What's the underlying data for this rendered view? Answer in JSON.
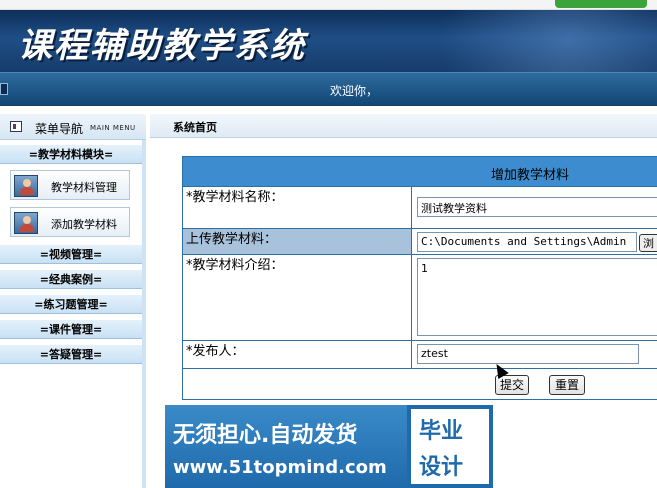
{
  "banner": {
    "title": "课程辅助教学系统"
  },
  "welcome": {
    "text": "欢迎你，"
  },
  "sidebar": {
    "menu_title": "菜单导航",
    "menu_title_en": "MAIN MENU",
    "modules": [
      {
        "label": "=教学材料模块="
      },
      {
        "label": "=视频管理="
      },
      {
        "label": "=经典案例="
      },
      {
        "label": "=练习题管理="
      },
      {
        "label": "=课件管理="
      },
      {
        "label": "=答疑管理="
      }
    ],
    "subitems": [
      {
        "label": "教学材料管理",
        "icon": "user-icon"
      },
      {
        "label": "添加教学材料",
        "icon": "user-icon"
      }
    ]
  },
  "main": {
    "breadcrumb": "系统首页",
    "form": {
      "title": "增加教学材料",
      "name_label": "*教学材料名称：",
      "name_value": "测试教学资料",
      "upload_label": "上传教学材料：",
      "upload_value": "C:\\Documents and Settings\\Admin",
      "browse_label": "浏",
      "intro_label": "*教学材料介绍：",
      "intro_value": "1",
      "publisher_label": "*发布人：",
      "publisher_value": "ztest",
      "submit_label": "提交",
      "reset_label": "重置"
    }
  },
  "ad": {
    "line1": "无须担心.自动发货",
    "line2": "www.51topmind.com",
    "box_line1": "毕业",
    "box_line2": "设计"
  }
}
